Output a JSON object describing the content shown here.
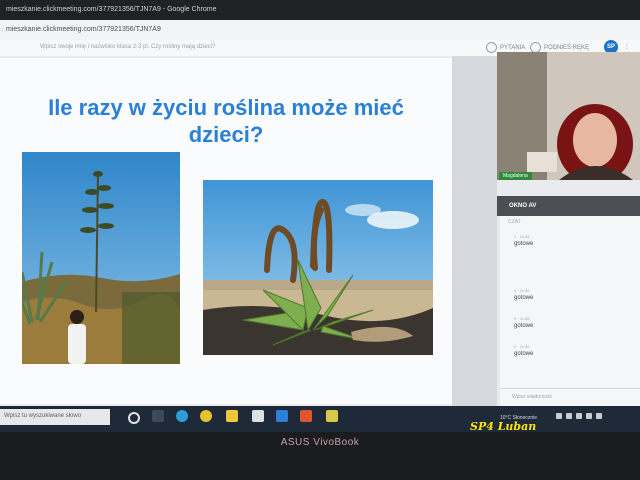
{
  "browser": {
    "title": "mieszkanie.clickmeeting.com/377921356/TJN7A9 - Google Chrome",
    "url": "mieszkanie.clickmeeting.com/377921356/TJN7A9"
  },
  "app": {
    "question": "Wpisz swoje imię i nazwisko klasa 2-3 pl. Czy rośliny mają dzieci?",
    "poll_label": "PYTANIA",
    "raise_hand_label": "PODNIEŚ RĘKĘ",
    "avatar_initials": "SP"
  },
  "slide": {
    "title_line1": "Ile razy w życiu roślina może mieć",
    "title_line2": "dzieci?"
  },
  "video": {
    "participant_name": "Magdalena"
  },
  "panel": {
    "okno_label": "OKNO AV",
    "chat_label": "CZAT"
  },
  "chat": {
    "messages": [
      {
        "meta": "1 · 11:36",
        "text": "gotowe"
      },
      {
        "meta": "4 · 11:36",
        "text": "gotowe"
      },
      {
        "meta": "5 · 11:36",
        "text": "gotowe"
      },
      {
        "meta": "2 · 11:36",
        "text": "gotowe"
      }
    ],
    "input_placeholder": "Wpisz wiadomość"
  },
  "taskbar": {
    "search_placeholder": "Wpisz tu wyszukiwane słowo",
    "weather": "10°C  Słonecznie"
  },
  "laptop": {
    "brand": "ASUS VivoBook"
  },
  "watermark": "SP4 Luban"
}
